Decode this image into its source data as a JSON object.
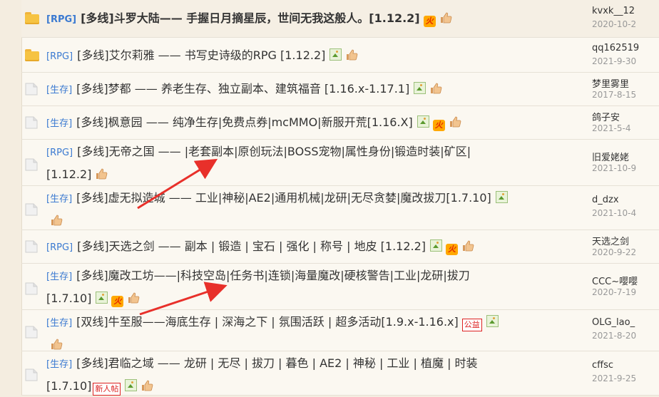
{
  "threads": [
    {
      "icon": "folder-icon",
      "hot": true,
      "tag": "[RPG]",
      "line1": "[多线]斗罗大陆—— 手握日月摘星辰，世间无我这般人。[1.12.2]",
      "line2": "",
      "badges_line": 1,
      "badges": [
        "hot",
        "thumb"
      ],
      "author": "kvxk__12",
      "date": "2020-10-2"
    },
    {
      "icon": "folder-icon",
      "hot": false,
      "tag": "[RPG]",
      "line1": "[多线]艾尔莉雅 —— 书写史诗级的RPG [1.12.2]",
      "line2": "",
      "badges_line": 1,
      "badges": [
        "image",
        "thumb"
      ],
      "author": "qq162519",
      "date": "2021-9-30"
    },
    {
      "icon": "page-icon",
      "hot": false,
      "tag": "[生存]",
      "line1": "[多线]梦都 —— 养老生存、独立副本、建筑福音 [1.16.x-1.17.1]",
      "line2": "",
      "badges_line": 1,
      "badges": [
        "image",
        "thumb"
      ],
      "author": "梦里雾里",
      "date": "2017-8-15"
    },
    {
      "icon": "page-icon",
      "hot": false,
      "tag": "[生存]",
      "line1": "[多线]枫意园 —— 纯净生存|免费点券|mcMMO|新服开荒[1.16.X]",
      "line2": "",
      "badges_line": 1,
      "badges": [
        "image",
        "hot",
        "thumb"
      ],
      "author": "鸽子安",
      "date": "2021-5-4"
    },
    {
      "icon": "page-icon",
      "hot": false,
      "tag": "[RPG]",
      "line1": "[多线]无帝之国 —— |老套副本|原创玩法|BOSS宠物|属性身份|锻造时装|矿区|",
      "line2": "[1.12.2]",
      "badges_line": 2,
      "badges": [
        "thumb"
      ],
      "author": "旧爱姥姥",
      "date": "2021-10-9"
    },
    {
      "icon": "page-icon",
      "hot": false,
      "tag": "[生存]",
      "line1": "[多线]虚无拟造城 —— 工业|神秘|AE2|通用机械|龙研|无尽贪婪|魔改拔刀[1.7.10]",
      "line2": "",
      "badges_line": 1,
      "badges": [
        "image"
      ],
      "extra_line2": [
        "thumb"
      ],
      "author": "d_dzx",
      "date": "2021-10-4"
    },
    {
      "icon": "page-icon",
      "hot": false,
      "tag": "[RPG]",
      "line1": "[多线]天选之剑 —— 副本 | 锻造 | 宝石 | 强化 | 称号 | 地皮 [1.12.2]",
      "line2": "",
      "badges_line": 1,
      "badges": [
        "image",
        "hot",
        "thumb"
      ],
      "author": "天选之剑",
      "date": "2020-9-22"
    },
    {
      "icon": "page-icon",
      "hot": false,
      "tag": "[生存]",
      "line1": "[多线]魔改工坊——|科技空岛|任务书|连锁|海量魔改|硬核警告|工业|龙研|拔刀",
      "line2": "[1.7.10]",
      "badges_line": 2,
      "badges": [
        "image",
        "hot",
        "thumb"
      ],
      "author": "CCC~嘤嘤",
      "date": "2020-7-19"
    },
    {
      "icon": "page-icon",
      "hot": false,
      "tag": "[生存]",
      "line1": "[双线]牛至服——海底生存 | 深海之下 | 氛围活跃 | 超多活动[1.9.x-1.16.x]",
      "line2": "",
      "badges_line": 1,
      "badges": [
        "gongyi",
        "image"
      ],
      "extra_line2": [
        "thumb"
      ],
      "author": "OLG_lao_",
      "date": "2021-8-20"
    },
    {
      "icon": "page-icon",
      "hot": false,
      "tag": "[生存]",
      "line1": "[多线]君临之域 —— 龙研 | 无尽 | 拔刀 | 暮色 | AE2 | 神秘 | 工业 | 植魔 | 时装",
      "line2": "[1.7.10]",
      "badges_line": 2,
      "badges": [
        "new",
        "image",
        "thumb"
      ],
      "author": "cffsc",
      "date": "2021-9-25"
    }
  ],
  "badge_text": {
    "hot": "火",
    "gongyi": "公益",
    "new": "新人帖"
  },
  "colors": {
    "tag": "#3b7ad1",
    "arrow": "#e8302a",
    "hot_badge": "#ffa800"
  }
}
